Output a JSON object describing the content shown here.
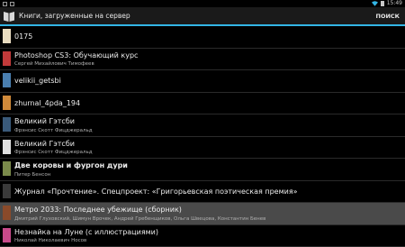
{
  "status_bar": {
    "time": "15:49"
  },
  "action_bar": {
    "title": "Книги, загруженные на сервер",
    "search_label": "ПОИСК"
  },
  "books": [
    {
      "title": "0175",
      "author": "",
      "bold": false,
      "selected": false,
      "thumb": "#e9dcc0"
    },
    {
      "title": "Photoshop CS3: Обучающий курс",
      "author": "Сергей Михайлович Тимофеев",
      "bold": false,
      "selected": false,
      "thumb": "#c23a3a"
    },
    {
      "title": "velikii_getsbi",
      "author": "",
      "bold": false,
      "selected": false,
      "thumb": "#4a7fb0"
    },
    {
      "title": "zhurnal_4pda_194",
      "author": "",
      "bold": false,
      "selected": false,
      "thumb": "#d08a3a"
    },
    {
      "title": "Великий Гэтсби",
      "author": "Фрэнсис Скотт Фицджеральд",
      "bold": false,
      "selected": false,
      "thumb": "#3a5a7a"
    },
    {
      "title": "Великий Гэтсби",
      "author": "Фрэнсис Скотт Фицджеральд",
      "bold": false,
      "selected": false,
      "thumb": "#e0e0e0"
    },
    {
      "title": "Две коровы и фургон дури",
      "author": "Питер Бенсон",
      "bold": true,
      "selected": false,
      "thumb": "#7a8a4a"
    },
    {
      "title": "Журнал «Прочтение». Спецпроект: «Григорьевская поэтическая премия»",
      "author": "",
      "bold": false,
      "selected": false,
      "thumb": "#3a3a3a"
    },
    {
      "title": "Метро 2033: Последнее убежище (сборник)",
      "author": "Дмитрий Глуховский, Шимун Врочек, Андрей Гребенщиков, Ольга Швецова, Константин Бенев",
      "bold": false,
      "selected": true,
      "thumb": "#8a4a2a"
    },
    {
      "title": "Незнайка на Луне (с иллюстрациями)",
      "author": "Николай Николаевич Носов",
      "bold": false,
      "selected": false,
      "thumb": "#c84a8a"
    }
  ]
}
